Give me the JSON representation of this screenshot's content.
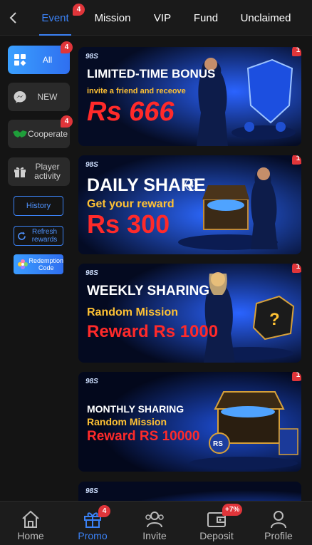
{
  "header": {
    "tabs": [
      {
        "label": "Event",
        "badge": "4",
        "active": true
      },
      {
        "label": "Mission"
      },
      {
        "label": "VIP"
      },
      {
        "label": "Fund"
      },
      {
        "label": "Unclaimed"
      }
    ]
  },
  "sidebar": {
    "items": [
      {
        "label": "All",
        "badge": "4",
        "icon": "grid-icon",
        "active": true
      },
      {
        "label": "NEW",
        "icon": "messenger-icon"
      },
      {
        "label": "Cooperate",
        "badge": "4",
        "icon": "handshake-icon"
      },
      {
        "label": "Player activity",
        "icon": "gift-icon"
      }
    ],
    "history_label": "History",
    "refresh_label": "Refresh rewards",
    "redeem_label": "Redemption Code"
  },
  "banners": [
    {
      "brand": "98S",
      "badge": "1",
      "line1": "LIMITED-TIME BONUS",
      "line2": "invite a friend and receove",
      "line3": "Rs 666"
    },
    {
      "brand": "98S",
      "badge": "1",
      "line1": "DAILY SHARE",
      "mark": "4",
      "line2": "Get your reward",
      "line3": "Rs 300"
    },
    {
      "brand": "98S",
      "badge": "1",
      "line1": "WEEKLY SHARING",
      "line2": "Random Mission",
      "line3": "Reward Rs 1000"
    },
    {
      "brand": "98S",
      "badge": "1",
      "line1": "MONTHLY SHARING",
      "line2": "Random Mission",
      "line3": "Reward RS 10000"
    },
    {
      "brand": "98S"
    }
  ],
  "bottom_nav": [
    {
      "label": "Home",
      "icon": "home-icon"
    },
    {
      "label": "Promo",
      "icon": "gift-icon",
      "badge": "4",
      "active": true
    },
    {
      "label": "Invite",
      "icon": "users-icon"
    },
    {
      "label": "Deposit",
      "icon": "wallet-icon",
      "badge": "+7%"
    },
    {
      "label": "Profile",
      "icon": "user-icon"
    }
  ],
  "colors": {
    "accent": "#3b82f6",
    "badge": "#e0353a",
    "background": "#141414",
    "banner_red": "#ff2a2a",
    "banner_gold": "#ffc234"
  }
}
